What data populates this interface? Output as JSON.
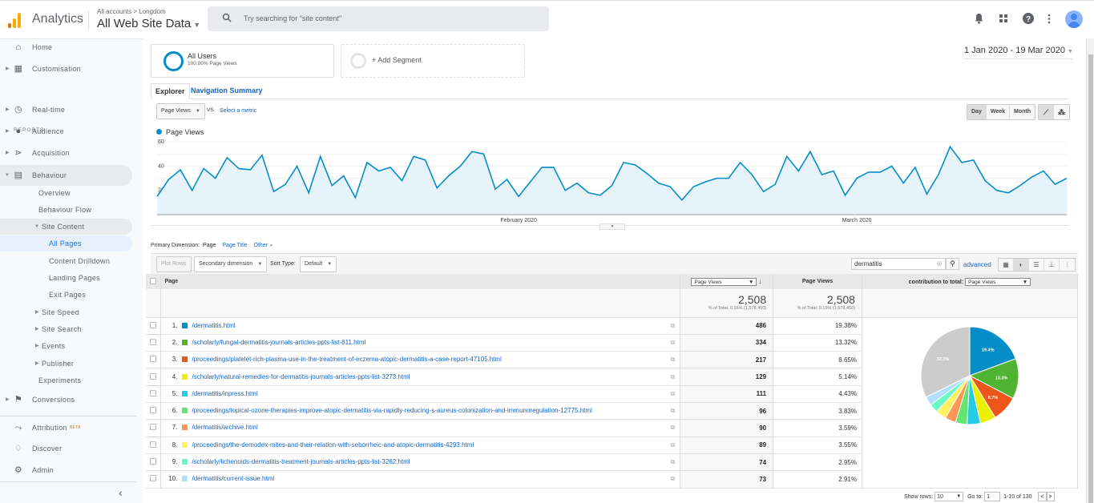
{
  "header": {
    "app_name": "Analytics",
    "breadcrumb": "All accounts > Longdom",
    "property": "All Web Site Data",
    "search_placeholder": "Try searching for \"site content\"",
    "icons": [
      "bell-icon",
      "apps-icon",
      "help-icon",
      "more-vert-icon",
      "avatar"
    ]
  },
  "sidebar": {
    "top_items": [
      {
        "label": "Home",
        "icon": "home-icon"
      },
      {
        "label": "Customisation",
        "icon": "dashboard-icon"
      }
    ],
    "section_label": "REPORTS",
    "report_items": [
      {
        "label": "Real-time",
        "icon": "clock-icon"
      },
      {
        "label": "Audience",
        "icon": "person-icon"
      },
      {
        "label": "Acquisition",
        "icon": "acquisition-icon"
      },
      {
        "label": "Behaviour",
        "icon": "behaviour-icon"
      }
    ],
    "behaviour_children": [
      "Overview",
      "Behaviour Flow"
    ],
    "site_content": "Site Content",
    "site_content_children": [
      "All Pages",
      "Content Drilldown",
      "Landing Pages",
      "Exit Pages"
    ],
    "other_children": [
      "Site Speed",
      "Site Search",
      "Events",
      "Publisher"
    ],
    "experiments": "Experiments",
    "conversions": "Conversions",
    "bottom_items": [
      {
        "label": "Attribution",
        "badge": "BETA"
      },
      {
        "label": "Discover"
      },
      {
        "label": "Admin"
      }
    ]
  },
  "segments": {
    "all_users": "All Users",
    "all_users_sub": "100.00% Page Views",
    "add": "+ Add Segment"
  },
  "date_range": "1 Jan 2020 - 19 Mar 2020",
  "tabs": [
    "Explorer",
    "Navigation Summary"
  ],
  "metric": {
    "selected": "Page Views",
    "vs": "VS",
    "select": "Select a metric"
  },
  "granularity": [
    "Day",
    "Week",
    "Month"
  ],
  "granularity_selected": "Day",
  "chart_data": {
    "type": "line",
    "series": [
      {
        "name": "Page Views",
        "color": "#058dc7",
        "values": [
          15,
          29,
          37,
          20,
          38,
          30,
          47,
          38,
          37,
          49,
          19,
          25,
          40,
          18,
          48,
          24,
          32,
          14,
          43,
          36,
          39,
          28,
          48,
          45,
          22,
          32,
          40,
          52,
          50,
          21,
          29,
          15,
          27,
          39,
          39,
          20,
          26,
          18,
          16,
          24,
          43,
          41,
          34,
          26,
          23,
          12,
          23,
          27,
          30,
          30,
          43,
          33,
          19,
          25,
          48,
          36,
          52,
          33,
          36,
          16,
          30,
          35,
          35,
          40,
          26,
          39,
          17,
          33,
          56,
          43,
          45,
          28,
          20,
          18,
          24,
          31,
          36,
          25,
          30
        ]
      }
    ],
    "x_start": "1 Jan 2020",
    "x_end": "19 Mar 2020",
    "x_labels": [
      {
        "label": "February 2020",
        "index": 31
      },
      {
        "label": "March 2020",
        "index": 60
      }
    ],
    "y_ticks": [
      20,
      40,
      60
    ],
    "ylim": [
      0,
      66
    ],
    "legend": "top-left",
    "grid": true
  },
  "primary_dimension": {
    "label": "Primary Dimension:",
    "current": "Page",
    "options": [
      "Page Title",
      "Other"
    ]
  },
  "table_toolbar": {
    "plot_rows": "Plot Rows",
    "secondary": "Secondary dimension",
    "sort_label": "Sort Type:",
    "sort_value": "Default",
    "search_value": "dermatitis",
    "advanced": "advanced"
  },
  "table": {
    "columns": {
      "page": "Page",
      "metric_dd": "Page Views",
      "metric": "Page Views",
      "contribution": "contribution to total:",
      "contribution_dd": "Page Views"
    },
    "totals": {
      "value": "2,508",
      "sub": "% of Total: 0.16% (1,578,450)"
    },
    "rows": [
      {
        "rank": "1.",
        "page": "/dermatitis.html",
        "views": "486",
        "pct": "19.38%",
        "color": "#058dc7"
      },
      {
        "rank": "2.",
        "page": "/scholarly/fungal-dermatitis-journals-articles-ppts-list-811.html",
        "views": "334",
        "pct": "13.32%",
        "color": "#50b432"
      },
      {
        "rank": "3.",
        "page": "/proceedings/platelet-rich-plasma-use-in-the-treatment-of-eczema-atopic-dermatitis-a-case-report-47105.html",
        "views": "217",
        "pct": "8.65%",
        "color": "#ed561b"
      },
      {
        "rank": "4.",
        "page": "/scholarly/natural-remedies-for-dermatitis-journals-articles-ppts-list-3273.html",
        "views": "129",
        "pct": "5.14%",
        "color": "#edef00"
      },
      {
        "rank": "5.",
        "page": "/dermatitis/inpress.html",
        "views": "111",
        "pct": "4.43%",
        "color": "#24cbe5"
      },
      {
        "rank": "6.",
        "page": "/proceedings/topical-ozone-therapies-improve-atopic-dermatitis-via-rapidly-reducing-s-aureus-colonization-and-immunoregulation-12775.html",
        "views": "96",
        "pct": "3.83%",
        "color": "#64e572"
      },
      {
        "rank": "7.",
        "page": "/dermatitis/archive.html",
        "views": "90",
        "pct": "3.59%",
        "color": "#ff9655"
      },
      {
        "rank": "8.",
        "page": "/proceedings/the-demodex-mites-and-their-relation-with-seborrheic-and-atopic-dermatitis-4293.html",
        "views": "89",
        "pct": "3.55%",
        "color": "#fff263"
      },
      {
        "rank": "9.",
        "page": "/scholarly/lichenoids-dermatitis-treatment-journals-articles-ppts-list-3262.html",
        "views": "74",
        "pct": "2.95%",
        "color": "#6af9c4"
      },
      {
        "rank": "10.",
        "page": "/dermatitis/current-issue.html",
        "views": "73",
        "pct": "2.91%",
        "color": "#b2deff"
      }
    ],
    "pie": {
      "other_pct": 32.3,
      "other_color": "#cccccc",
      "labels": [
        "19.4%",
        "13.3%",
        "8.7%"
      ],
      "other_label": "32.3%"
    }
  },
  "pager": {
    "show_rows": "Show rows:",
    "rows": "10",
    "goto": "Go to:",
    "page": "1",
    "range": "1-10 of 130"
  }
}
